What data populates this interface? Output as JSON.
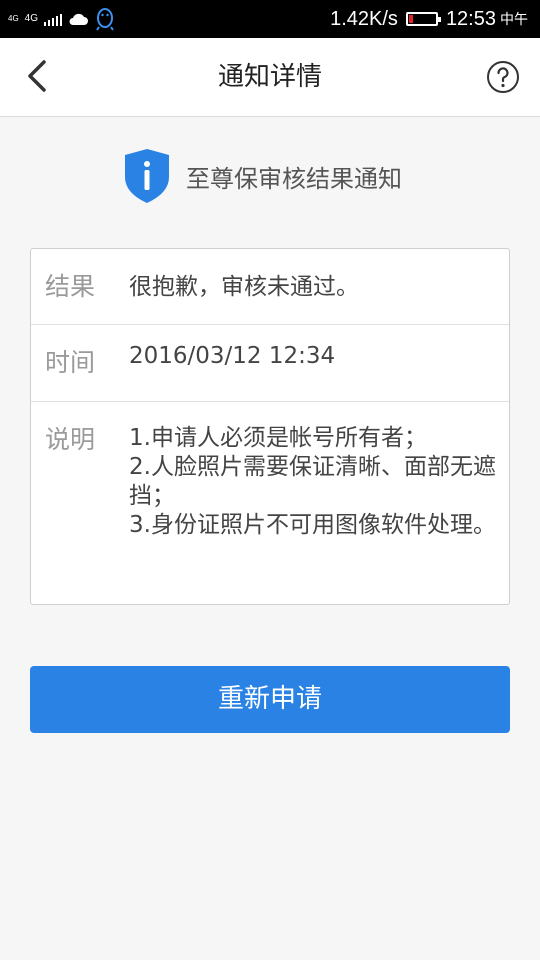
{
  "status_bar": {
    "network_small": "4G",
    "network": "4G",
    "speed": "1.42K/s",
    "time": "12:53",
    "ampm": "中午",
    "battery_level": 0.15,
    "battery_color": "#e0262c"
  },
  "header": {
    "title": "通知详情",
    "back_icon": "chevron-left-icon",
    "help_icon": "help-circle-icon"
  },
  "notice": {
    "icon": "shield-info-icon",
    "text": "至尊保审核结果通知",
    "icon_color": "#2a82e4"
  },
  "details": {
    "result_label": "结果",
    "result_value": "很抱歉，审核未通过。",
    "time_label": "时间",
    "time_value": "2016/03/12 12:34",
    "desc_label": "说明",
    "desc_items": [
      "1.申请人必须是帐号所有者；",
      "2.人脸照片需要保证清晰、面部无遮挡；",
      "3.身份证照片不可用图像软件处理。"
    ]
  },
  "actions": {
    "reapply_label": "重新申请",
    "accent_color": "#2a82e4"
  }
}
